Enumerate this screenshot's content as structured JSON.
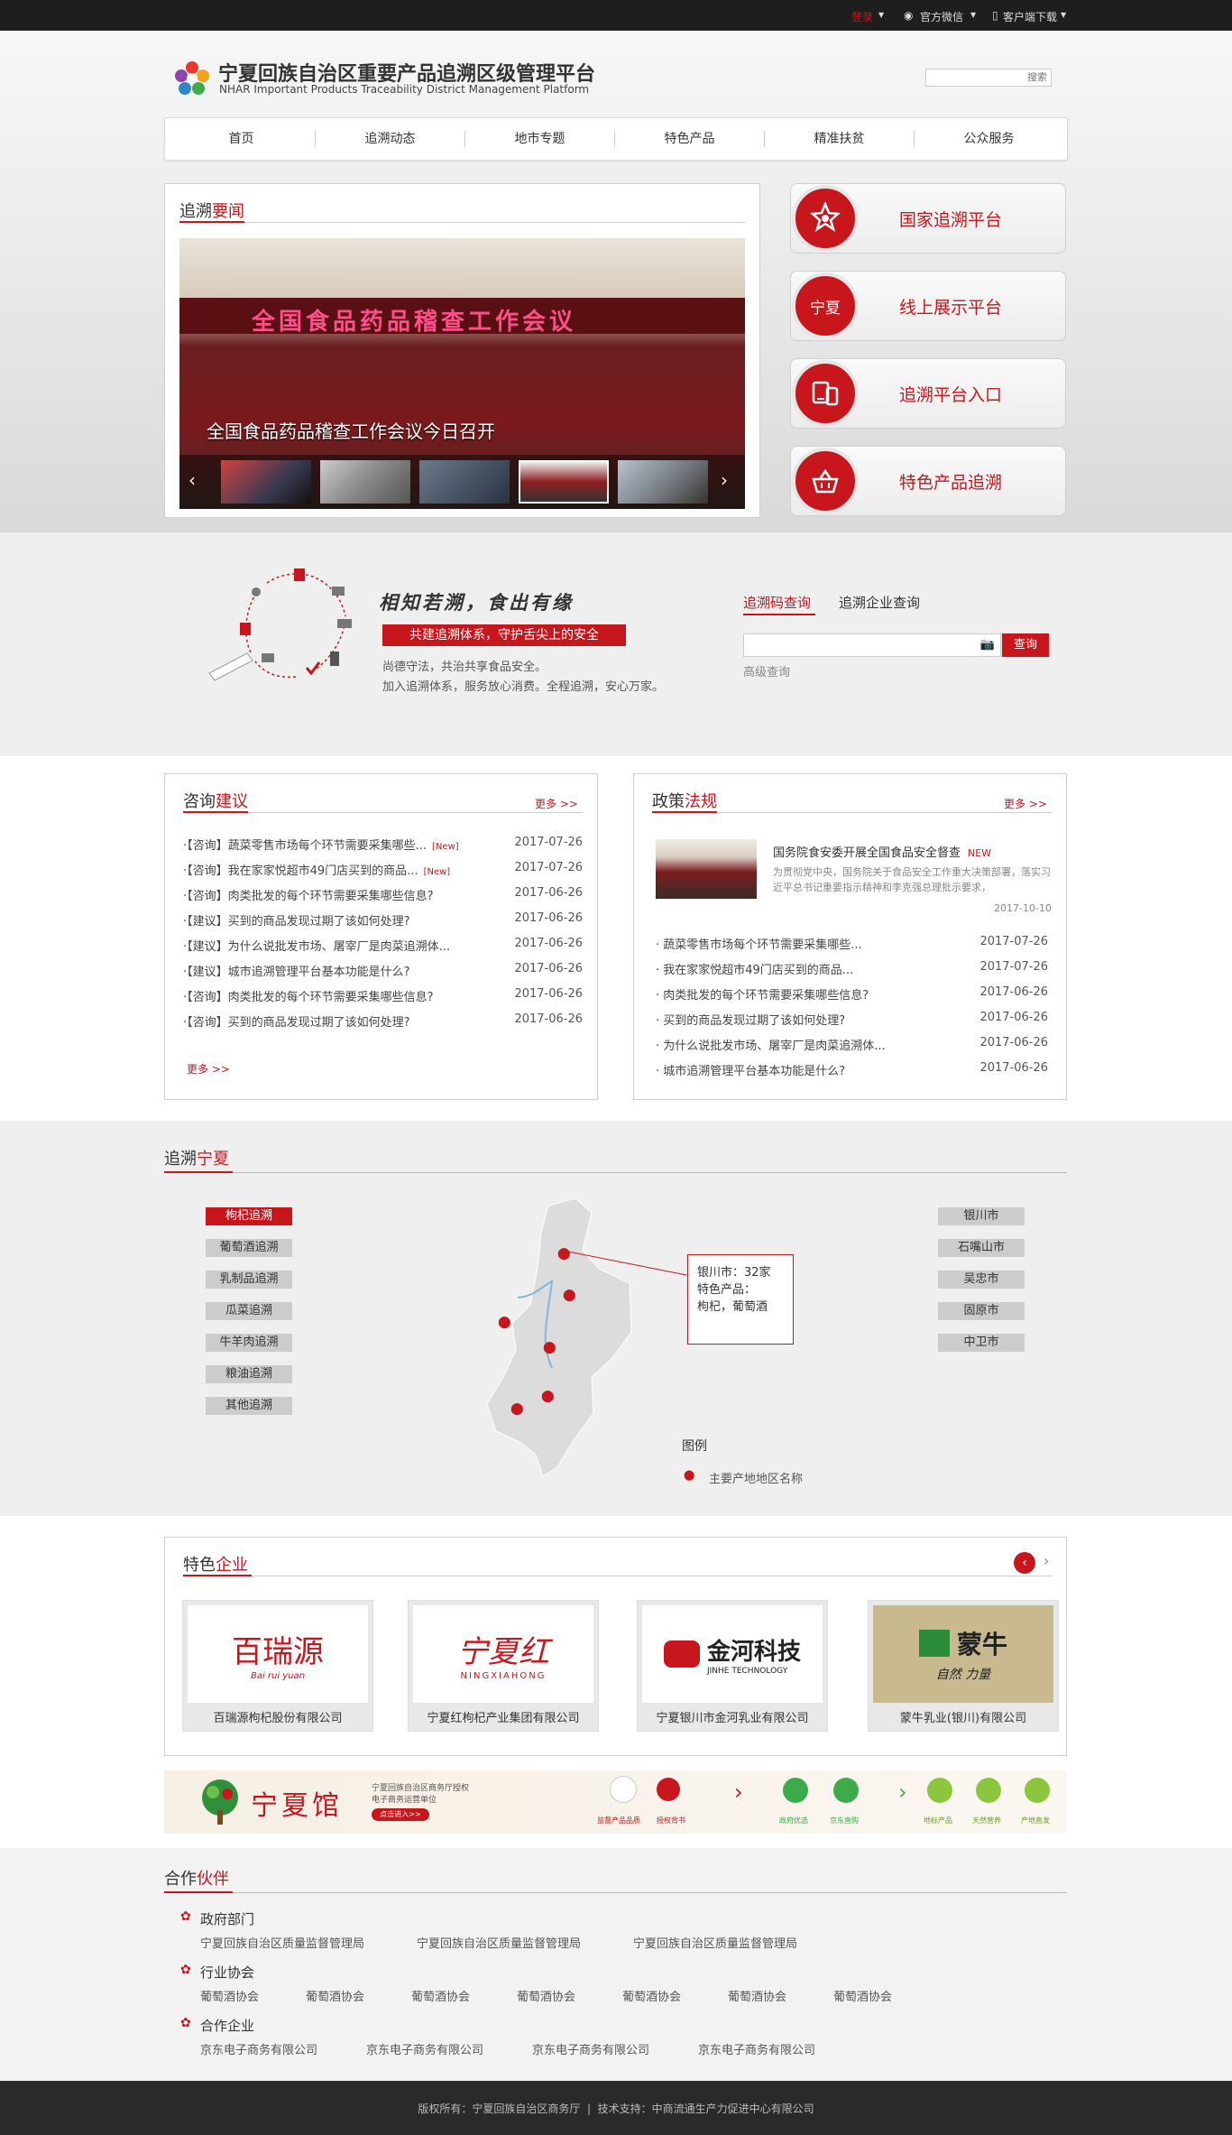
{
  "topbar": {
    "login": "登录",
    "wechat": "官方微信",
    "download": "客户端下载"
  },
  "header": {
    "title": "宁夏回族自治区重要产品追溯区级管理平台",
    "subtitle": "NHAR Important Products Traceability District Management Platform",
    "search_placeholder": "搜索"
  },
  "nav": {
    "items": [
      "首页",
      "追溯动态",
      "地市专题",
      "特色产品",
      "精准扶贫",
      "公众服务"
    ]
  },
  "news": {
    "title_a": "追溯",
    "title_b": "要闻",
    "slide_caption": "全国食品药品稽查工作会议今日召开",
    "banner_text": "全国食品药品稽查工作会议"
  },
  "quick_links": [
    {
      "label": "国家追溯平台",
      "icon": "national-emblem-icon"
    },
    {
      "label": "线上展示平台",
      "icon": "ningxia-logo-icon",
      "glyph": "宁夏"
    },
    {
      "label": "追溯平台入口",
      "icon": "devices-icon"
    },
    {
      "label": "特色产品追溯",
      "icon": "basket-icon"
    }
  ],
  "trace": {
    "slogan": "相知若溯，食出有缘",
    "ribbon": "共建追溯体系，守护舌尖上的安全",
    "line1": "尚德守法，共治共享食品安全。",
    "line2": "加入追溯体系，服务放心消费。全程追溯，安心万家。",
    "tab_code": "追溯码查询",
    "tab_company": "追溯企业查询",
    "query_button": "查询",
    "advanced": "高级查询"
  },
  "consult": {
    "title_a": "咨询",
    "title_b": "建议",
    "more": "更多 >>",
    "more_bottom": "更多 >>",
    "items": [
      {
        "text": "·【咨询】蔬菜零售市场每个环节需要采集哪些...",
        "new": "[New]",
        "date": "2017-07-26"
      },
      {
        "text": "·【咨询】我在家家悦超市49门店买到的商品...",
        "new": "[New]",
        "date": "2017-07-26"
      },
      {
        "text": "·【咨询】肉类批发的每个环节需要采集哪些信息?",
        "new": "",
        "date": "2017-06-26"
      },
      {
        "text": "·【建议】买到的商品发现过期了该如何处理?",
        "new": "",
        "date": "2017-06-26"
      },
      {
        "text": "·【建议】为什么说批发市场、屠宰厂是肉菜追溯体...",
        "new": "",
        "date": "2017-06-26"
      },
      {
        "text": "·【建议】城市追溯管理平台基本功能是什么?",
        "new": "",
        "date": "2017-06-26"
      },
      {
        "text": "·【咨询】肉类批发的每个环节需要采集哪些信息?",
        "new": "",
        "date": "2017-06-26"
      },
      {
        "text": "·【咨询】买到的商品发现过期了该如何处理?",
        "new": "",
        "date": "2017-06-26"
      }
    ]
  },
  "policy": {
    "title_a": "政策",
    "title_b": "法规",
    "more": "更多 >>",
    "featured": {
      "title": "国务院食安委开展全国食品安全督查",
      "new": "NEW",
      "desc": "为贯彻党中央，国务院关于食品安全工作重大决策部署，落实习近平总书记重要指示精神和李克强总理批示要求，",
      "date": "2017-10-10"
    },
    "items": [
      {
        "text": "· 蔬菜零售市场每个环节需要采集哪些...",
        "date": "2017-07-26"
      },
      {
        "text": "· 我在家家悦超市49门店买到的商品...",
        "date": "2017-07-26"
      },
      {
        "text": "· 肉类批发的每个环节需要采集哪些信息?",
        "date": "2017-06-26"
      },
      {
        "text": "· 买到的商品发现过期了该如何处理?",
        "date": "2017-06-26"
      },
      {
        "text": "· 为什么说批发市场、屠宰厂是肉菜追溯体...",
        "date": "2017-06-26"
      },
      {
        "text": "· 城市追溯管理平台基本功能是什么?",
        "date": "2017-06-26"
      }
    ]
  },
  "ningxia": {
    "title_a": "追溯",
    "title_b": "宁夏",
    "categories": [
      "枸杞追溯",
      "葡萄酒追溯",
      "乳制品追溯",
      "瓜菜追溯",
      "牛羊肉追溯",
      "粮油追溯",
      "其他追溯"
    ],
    "cities": [
      "银川市",
      "石嘴山市",
      "吴忠市",
      "固原市",
      "中卫市"
    ],
    "tooltip": {
      "line1": "银川市：32家",
      "line2": "特色产品：",
      "line3": "枸杞，葡萄酒"
    },
    "legend_title": "图例",
    "legend_item": "主要产地地区名称"
  },
  "enterprises": {
    "title_a": "特色",
    "title_b": "企业",
    "items": [
      {
        "name": "百瑞源枸杞股份有限公司",
        "logo_text": "百瑞源",
        "logo_sub": "Bai rui yuan"
      },
      {
        "name": "宁夏红枸杞产业集团有限公司",
        "logo_text": "宁夏红",
        "logo_sub": "NINGXIAHONG"
      },
      {
        "name": "宁夏银川市金河乳业有限公司",
        "logo_text": "金河科技",
        "logo_sub": "JINHE TECHNOLOGY"
      },
      {
        "name": "蒙牛乳业(银川)有限公司",
        "logo_text": "蒙牛",
        "logo_sub": "自然 力量"
      }
    ]
  },
  "ad_banner": {
    "brand": "宁夏馆",
    "line1": "宁夏回族自治区商务厅授权",
    "line2": "电子商务运营单位",
    "cta": "点击进入>>",
    "labels": [
      "监督产品品质",
      "授权背书",
      "政府优选",
      "京东直购",
      "地标产品",
      "天然营养",
      "产地直发"
    ]
  },
  "partners": {
    "title_a": "合作",
    "title_b": "伙伴",
    "groups": [
      {
        "name": "政府部门",
        "items": [
          "宁夏回族自治区质量监督管理局",
          "宁夏回族自治区质量监督管理局",
          "宁夏回族自治区质量监督管理局"
        ]
      },
      {
        "name": "行业协会",
        "items": [
          "葡萄酒协会",
          "葡萄酒协会",
          "葡萄酒协会",
          "葡萄酒协会",
          "葡萄酒协会",
          "葡萄酒协会",
          "葡萄酒协会"
        ]
      },
      {
        "name": "合作企业",
        "items": [
          "京东电子商务有限公司",
          "京东电子商务有限公司",
          "京东电子商务有限公司",
          "京东电子商务有限公司"
        ]
      }
    ]
  },
  "footer": {
    "text": "版权所有：宁夏回族自治区商务厅  |  技术支持：中商流通生产力促进中心有限公司"
  },
  "colors": {
    "accent": "#c8161d",
    "topbar": "#1e1e1e",
    "gray_band": "#efefef"
  }
}
